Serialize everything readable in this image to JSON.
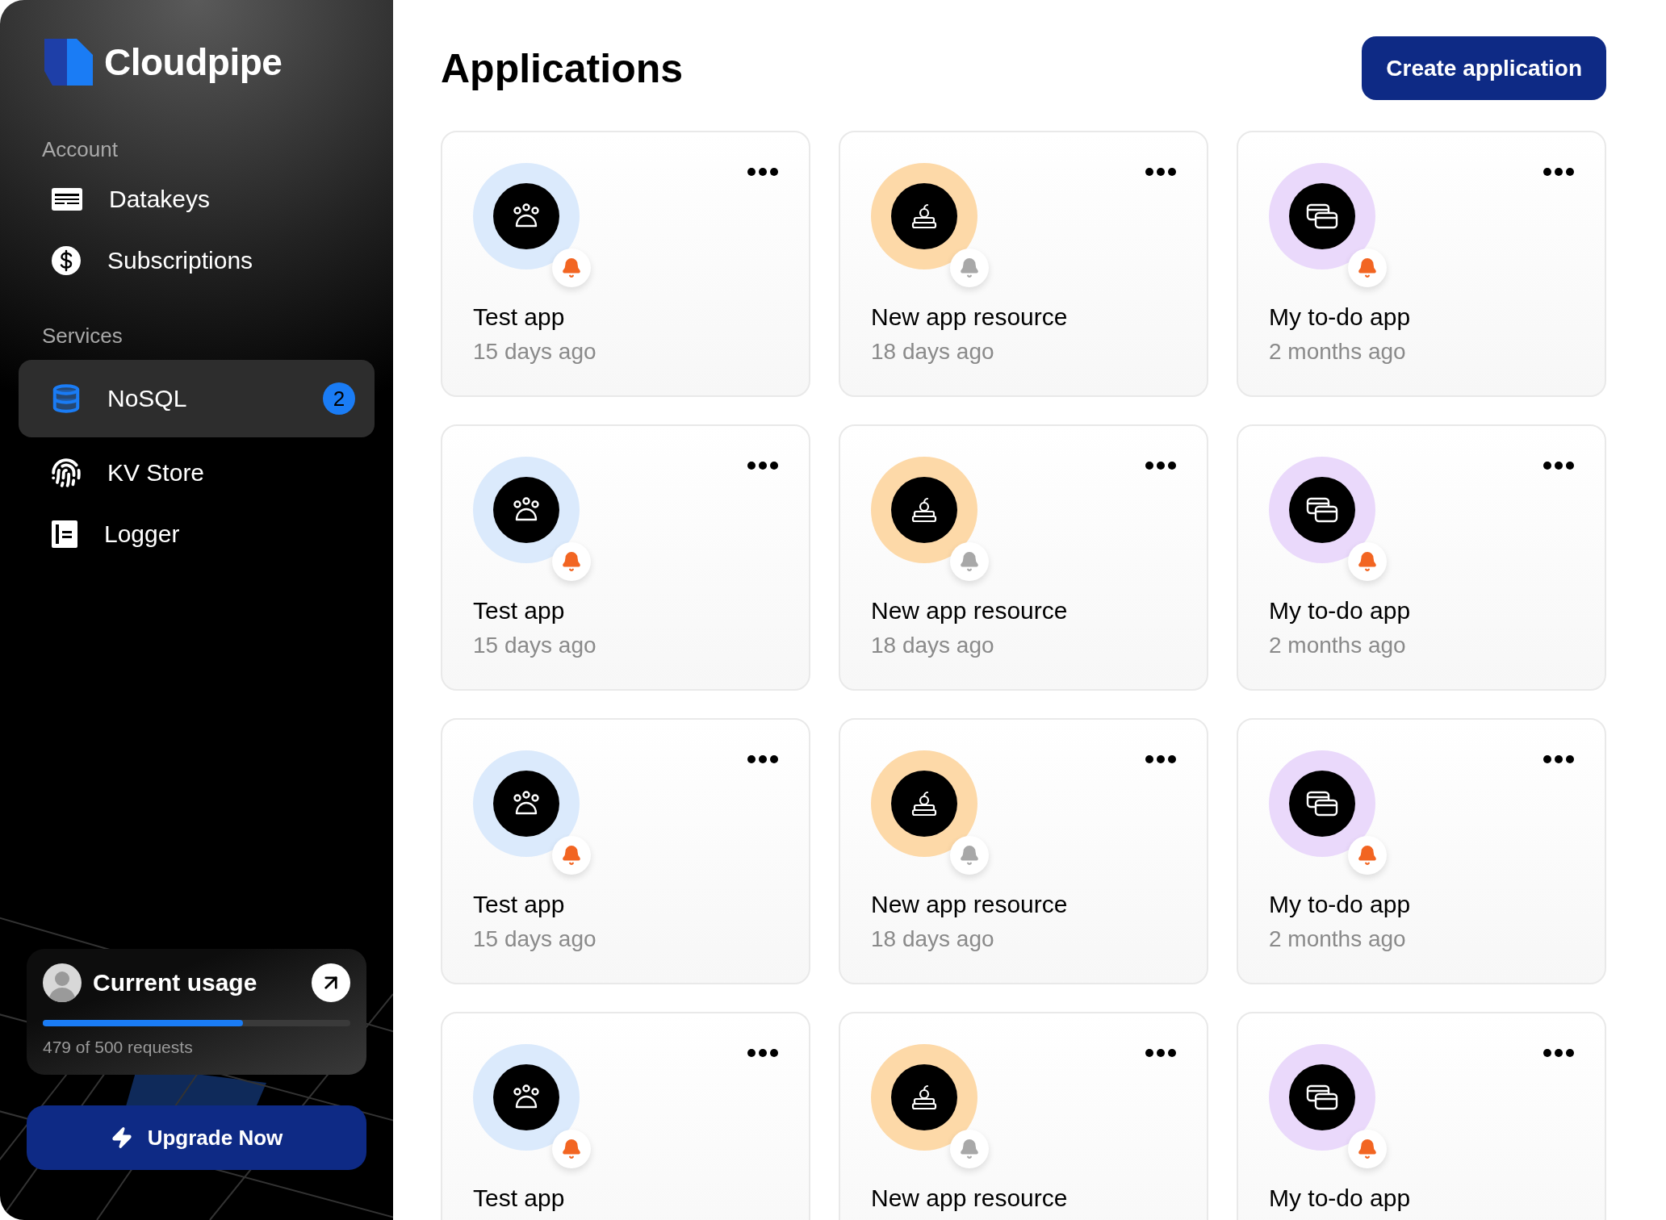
{
  "sidebar": {
    "brand": "Cloudpipe",
    "sections": [
      {
        "heading": "Account",
        "items": [
          {
            "label": "Datakeys",
            "kind": "datakeys",
            "selected": false
          },
          {
            "label": "Subscriptions",
            "kind": "dollar",
            "selected": false
          }
        ]
      },
      {
        "heading": "Services",
        "items": [
          {
            "label": "NoSQL",
            "kind": "database",
            "selected": true,
            "badge": "2"
          },
          {
            "label": "KV Store",
            "kind": "fingerprint",
            "selected": false
          },
          {
            "label": "Logger",
            "kind": "logger",
            "selected": false
          }
        ]
      }
    ],
    "usage": {
      "title": "Current usage",
      "level": 0.65,
      "caption": "479 of 500 requests"
    },
    "upgrade_button": "Upgrade Now"
  },
  "main": {
    "title": "Applications",
    "create_button": "Create application",
    "apps": [
      {
        "kind": "paw",
        "color": "#dbeafc",
        "name": "Test app",
        "age": "15 days ago",
        "notifications": true
      },
      {
        "kind": "books",
        "color": "#fdd9a8",
        "name": "New app resource",
        "age": "18 days ago",
        "notifications": false
      },
      {
        "kind": "cards",
        "color": "#ead9fb",
        "name": "My to-do app",
        "age": "2 months ago",
        "notifications": true
      },
      {
        "kind": "paw",
        "color": "#dbeafc",
        "name": "Test app",
        "age": "15 days ago",
        "notifications": true
      },
      {
        "kind": "books",
        "color": "#fdd9a8",
        "name": "New app resource",
        "age": "18 days ago",
        "notifications": false
      },
      {
        "kind": "cards",
        "color": "#ead9fb",
        "name": "My to-do app",
        "age": "2 months ago",
        "notifications": true
      },
      {
        "kind": "paw",
        "color": "#dbeafc",
        "name": "Test app",
        "age": "15 days ago",
        "notifications": true
      },
      {
        "kind": "books",
        "color": "#fdd9a8",
        "name": "New app resource",
        "age": "18 days ago",
        "notifications": false
      },
      {
        "kind": "cards",
        "color": "#ead9fb",
        "name": "My to-do app",
        "age": "2 months ago",
        "notifications": true
      },
      {
        "kind": "paw",
        "color": "#dbeafc",
        "name": "Test app",
        "notifications": true
      },
      {
        "kind": "books",
        "color": "#fdd9a8",
        "name": "New app resource",
        "notifications": false
      },
      {
        "kind": "cards",
        "color": "#ead9fb",
        "name": "My to-do app",
        "notifications": true
      }
    ]
  }
}
